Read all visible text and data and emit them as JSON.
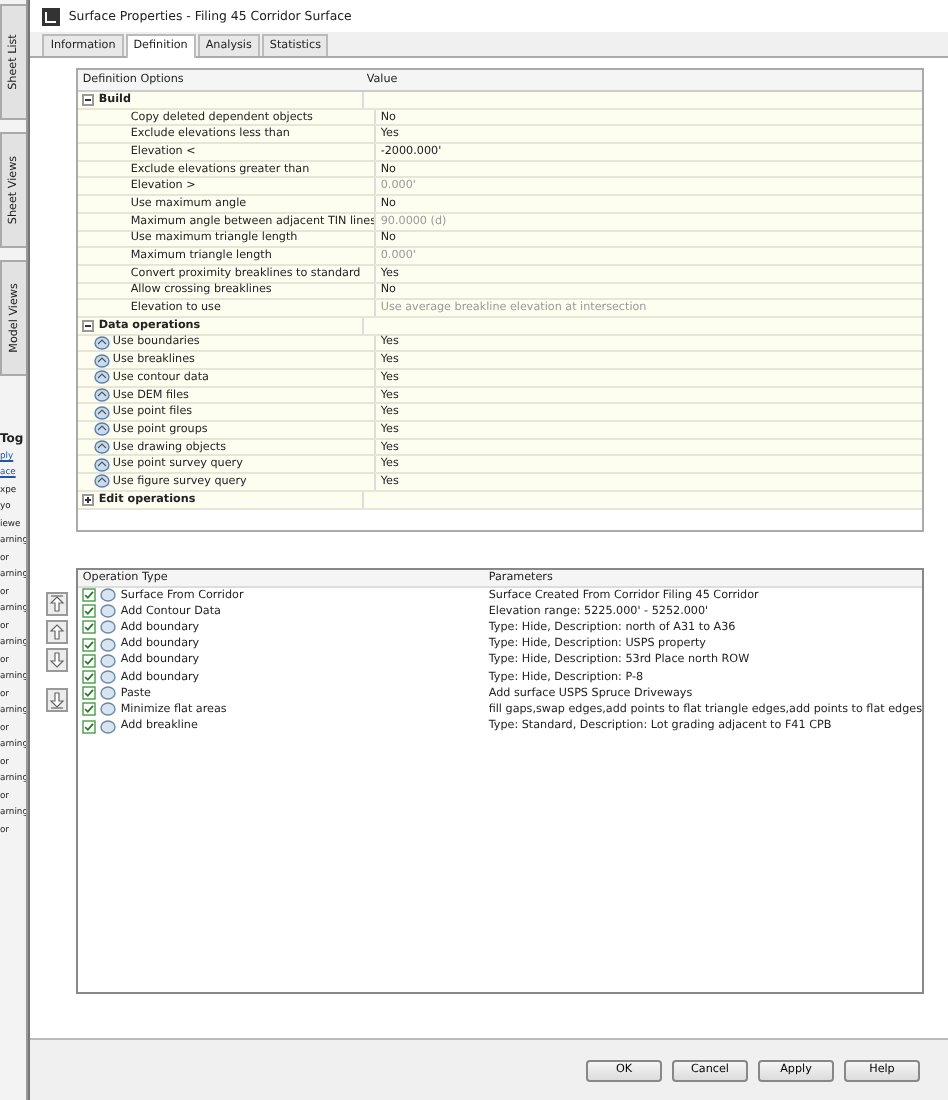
{
  "side_tabs": [
    {
      "label": "Sheet List"
    },
    {
      "label": "Sheet Views"
    },
    {
      "label": "Model Views"
    }
  ],
  "background_texts": [
    {
      "text": "Tog",
      "kind": "bold"
    },
    {
      "text": "ply",
      "kind": "link"
    },
    {
      "text": "ace",
      "kind": "link"
    },
    {
      "text": "xpe",
      "kind": "plain"
    },
    {
      "text": "yo",
      "kind": "plain"
    },
    {
      "text": "iewe",
      "kind": "plain"
    },
    {
      "text": "arning",
      "kind": "plain"
    },
    {
      "text": "or",
      "kind": "plain"
    },
    {
      "text": "arning",
      "kind": "plain"
    },
    {
      "text": "or",
      "kind": "plain"
    },
    {
      "text": "arning",
      "kind": "plain"
    },
    {
      "text": "or",
      "kind": "plain"
    },
    {
      "text": "arning",
      "kind": "plain"
    },
    {
      "text": "or",
      "kind": "plain"
    },
    {
      "text": "arning",
      "kind": "plain"
    },
    {
      "text": "or",
      "kind": "plain"
    },
    {
      "text": "arning",
      "kind": "plain"
    },
    {
      "text": "or",
      "kind": "plain"
    },
    {
      "text": "arning",
      "kind": "plain"
    },
    {
      "text": "or",
      "kind": "plain"
    },
    {
      "text": "arning",
      "kind": "plain"
    },
    {
      "text": "or",
      "kind": "plain"
    },
    {
      "text": "arning",
      "kind": "plain"
    },
    {
      "text": "or",
      "kind": "plain"
    }
  ],
  "window": {
    "title": "Surface Properties - Filing 45 Corridor Surface"
  },
  "tabs": [
    {
      "label": "Information",
      "selected": false
    },
    {
      "label": "Definition",
      "selected": true
    },
    {
      "label": "Analysis",
      "selected": false
    },
    {
      "label": "Statistics",
      "selected": false
    }
  ],
  "definition_grid": {
    "columns": [
      "Definition Options",
      "Value"
    ],
    "groups": [
      {
        "name": "Build",
        "expanded": true,
        "rows": [
          {
            "option": "Copy deleted dependent objects",
            "value": "No",
            "disabled": false
          },
          {
            "option": "Exclude elevations less than",
            "value": "Yes",
            "disabled": false
          },
          {
            "option": "Elevation <",
            "value": "-2000.000'",
            "disabled": false
          },
          {
            "option": "Exclude elevations greater than",
            "value": "No",
            "disabled": false
          },
          {
            "option": "Elevation >",
            "value": "0.000'",
            "disabled": true
          },
          {
            "option": "Use maximum angle",
            "value": "No",
            "disabled": false
          },
          {
            "option": "Maximum angle between adjacent TIN lines",
            "value": "90.0000 (d)",
            "disabled": true
          },
          {
            "option": "Use maximum triangle length",
            "value": "No",
            "disabled": false
          },
          {
            "option": "Maximum triangle length",
            "value": "0.000'",
            "disabled": true
          },
          {
            "option": "Convert proximity breaklines to standard",
            "value": "Yes",
            "disabled": false
          },
          {
            "option": "Allow crossing breaklines",
            "value": "No",
            "disabled": false
          },
          {
            "option": "Elevation to use",
            "value": "Use average breakline elevation at intersection",
            "disabled": true
          }
        ]
      },
      {
        "name": "Data operations",
        "expanded": true,
        "rows": [
          {
            "option": "Use boundaries",
            "value": "Yes",
            "disabled": false
          },
          {
            "option": "Use breaklines",
            "value": "Yes",
            "disabled": false
          },
          {
            "option": "Use contour data",
            "value": "Yes",
            "disabled": false
          },
          {
            "option": "Use DEM files",
            "value": "Yes",
            "disabled": false
          },
          {
            "option": "Use point files",
            "value": "Yes",
            "disabled": false
          },
          {
            "option": "Use point groups",
            "value": "Yes",
            "disabled": false
          },
          {
            "option": "Use drawing objects",
            "value": "Yes",
            "disabled": false
          },
          {
            "option": "Use point survey query",
            "value": "Yes",
            "disabled": false
          },
          {
            "option": "Use figure survey query",
            "value": "Yes",
            "disabled": false
          }
        ]
      },
      {
        "name": "Edit operations",
        "expanded": false
      }
    ]
  },
  "operations": {
    "columns": [
      "Operation Type",
      "Parameters"
    ],
    "rows": [
      {
        "type": "Surface From Corridor",
        "parameters": "Surface Created From Corridor Filing 45 Corridor",
        "checked": true
      },
      {
        "type": "Add Contour Data",
        "parameters": "Elevation range: 5225.000' - 5252.000'",
        "checked": true
      },
      {
        "type": "Add boundary",
        "parameters": "Type: Hide,  Description: north of A31 to A36",
        "checked": true
      },
      {
        "type": "Add boundary",
        "parameters": "Type: Hide,  Description: USPS property",
        "checked": true
      },
      {
        "type": "Add boundary",
        "parameters": "Type: Hide,  Description: 53rd Place north ROW",
        "checked": true
      },
      {
        "type": "Add boundary",
        "parameters": "Type: Hide,  Description: P-8",
        "checked": true
      },
      {
        "type": "Paste",
        "parameters": "Add surface USPS Spruce Driveways",
        "checked": true
      },
      {
        "type": "Minimize flat areas",
        "parameters": "fill gaps,swap edges,add points to flat triangle edges,add points to flat edges",
        "checked": true
      },
      {
        "type": "Add breakline",
        "parameters": "Type: Standard,  Description: Lot grading adjacent to F41 CPB",
        "checked": true
      }
    ]
  },
  "buttons": [
    "OK",
    "Cancel",
    "Apply",
    "Help"
  ]
}
